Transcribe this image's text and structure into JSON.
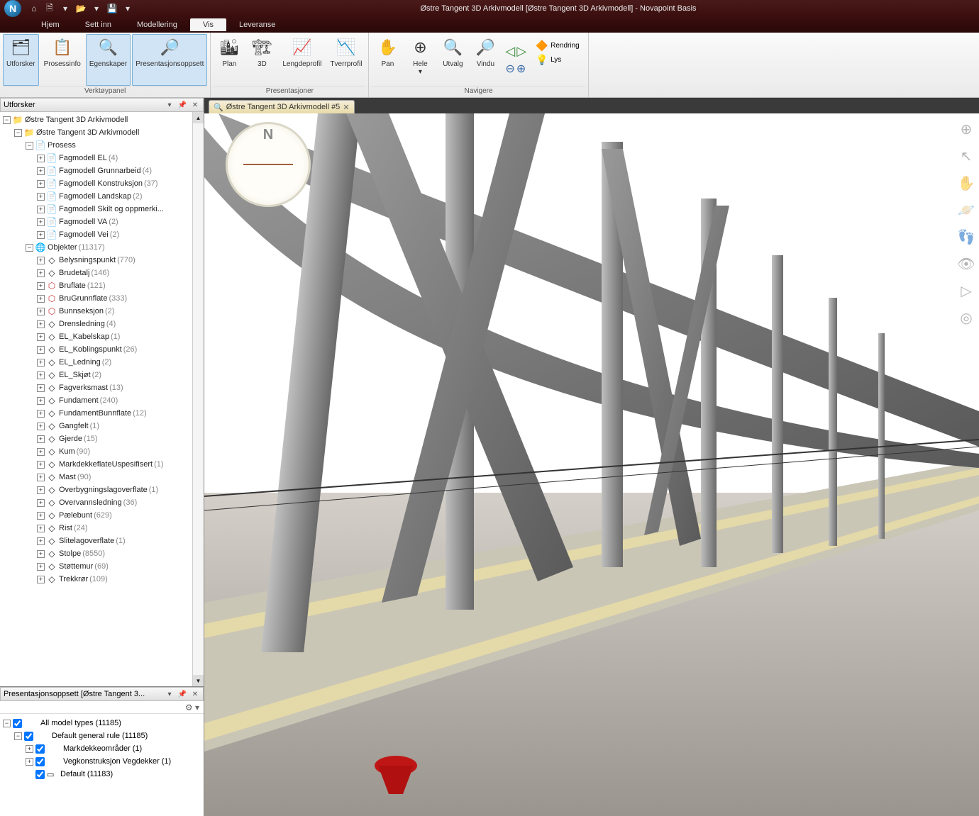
{
  "title_bar": {
    "app_initial": "N",
    "title": "Østre Tangent 3D Arkivmodell [Østre Tangent 3D Arkivmodell] - Novapoint Basis"
  },
  "menu": {
    "tabs": [
      "Hjem",
      "Sett inn",
      "Modellering",
      "Vis",
      "Leveranse"
    ],
    "active": "Vis"
  },
  "ribbon": {
    "group1_label": "Verktøypanel",
    "group2_label": "Presentasjoner",
    "group3_label": "Navigere",
    "utforsker": "Utforsker",
    "prosessinfo": "Prosessinfo",
    "egenskaper": "Egenskaper",
    "presopp": "Presentasjonsoppsett",
    "plan": "Plan",
    "three_d": "3D",
    "lengdeprofil": "Lengdeprofil",
    "tverrprofil": "Tverrprofil",
    "pan": "Pan",
    "hele": "Hele",
    "utvalg": "Utvalg",
    "vindu": "Vindu",
    "rendring": "Rendring",
    "lys": "Lys"
  },
  "explorer": {
    "panel_title": "Utforsker",
    "root": "Østre Tangent 3D Arkivmodell",
    "project": "Østre Tangent 3D Arkivmodell",
    "prosess": "Prosess",
    "prosess_items": [
      {
        "name": "Fagmodell EL",
        "count": "(4)"
      },
      {
        "name": "Fagmodell Grunnarbeid",
        "count": "(4)"
      },
      {
        "name": "Fagmodell Konstruksjon",
        "count": "(37)"
      },
      {
        "name": "Fagmodell Landskap",
        "count": "(2)"
      },
      {
        "name": "Fagmodell Skilt og oppmerki...",
        "count": ""
      },
      {
        "name": "Fagmodell VA",
        "count": "(2)"
      },
      {
        "name": "Fagmodell Vei",
        "count": "(2)"
      }
    ],
    "objekter": "Objekter",
    "objekter_count": "(11317)",
    "objekter_items": [
      {
        "name": "Belysningspunkt",
        "count": "(770)",
        "ico": "◇"
      },
      {
        "name": "Brudetalj",
        "count": "(146)",
        "ico": "◇"
      },
      {
        "name": "Bruflate",
        "count": "(121)",
        "ico": "⬡",
        "red": true
      },
      {
        "name": "BruGrunnflate",
        "count": "(333)",
        "ico": "⬡",
        "red": true
      },
      {
        "name": "Bunnseksjon",
        "count": "(2)",
        "ico": "⬡",
        "red": true
      },
      {
        "name": "Drensledning",
        "count": "(4)",
        "ico": "◇"
      },
      {
        "name": "EL_Kabelskap",
        "count": "(1)",
        "ico": "◇"
      },
      {
        "name": "EL_Koblingspunkt",
        "count": "(26)",
        "ico": "◇"
      },
      {
        "name": "EL_Ledning",
        "count": "(2)",
        "ico": "◇"
      },
      {
        "name": "EL_Skjøt",
        "count": "(2)",
        "ico": "◇"
      },
      {
        "name": "Fagverksmast",
        "count": "(13)",
        "ico": "◇"
      },
      {
        "name": "Fundament",
        "count": "(240)",
        "ico": "◇"
      },
      {
        "name": "FundamentBunnflate",
        "count": "(12)",
        "ico": "◇"
      },
      {
        "name": "Gangfelt",
        "count": "(1)",
        "ico": "◇"
      },
      {
        "name": "Gjerde",
        "count": "(15)",
        "ico": "◇"
      },
      {
        "name": "Kum",
        "count": "(90)",
        "ico": "◇"
      },
      {
        "name": "MarkdekkeflateUspesifisert",
        "count": "(1)",
        "ico": "◇"
      },
      {
        "name": "Mast",
        "count": "(90)",
        "ico": "◇"
      },
      {
        "name": "Overbygningslagoverflate",
        "count": "(1)",
        "ico": "◇"
      },
      {
        "name": "Overvannsledning",
        "count": "(36)",
        "ico": "◇"
      },
      {
        "name": "Pælebunt",
        "count": "(629)",
        "ico": "◇"
      },
      {
        "name": "Rist",
        "count": "(24)",
        "ico": "◇"
      },
      {
        "name": "Slitelagoverflate",
        "count": "(1)",
        "ico": "◇"
      },
      {
        "name": "Stolpe",
        "count": "(8550)",
        "ico": "◇"
      },
      {
        "name": "Støttemur",
        "count": "(69)",
        "ico": "◇"
      },
      {
        "name": "Trekkrør",
        "count": "(109)",
        "ico": "◇"
      }
    ]
  },
  "presentation": {
    "panel_title": "Presentasjonsoppsett [Østre Tangent 3...",
    "all_model": "All model types",
    "all_model_count": "(11185)",
    "default_rule": "Default general rule",
    "default_rule_count": "(11185)",
    "markdekke": "Markdekkeområder",
    "markdekke_count": "(1)",
    "vegkon": "Vegkonstruksjon Vegdekker",
    "vegkon_count": "(1)",
    "default": "Default",
    "default_count": "(11183)"
  },
  "view_tab": {
    "label": "Østre Tangent 3D Arkivmodell #5"
  },
  "compass": {
    "north": "N"
  }
}
